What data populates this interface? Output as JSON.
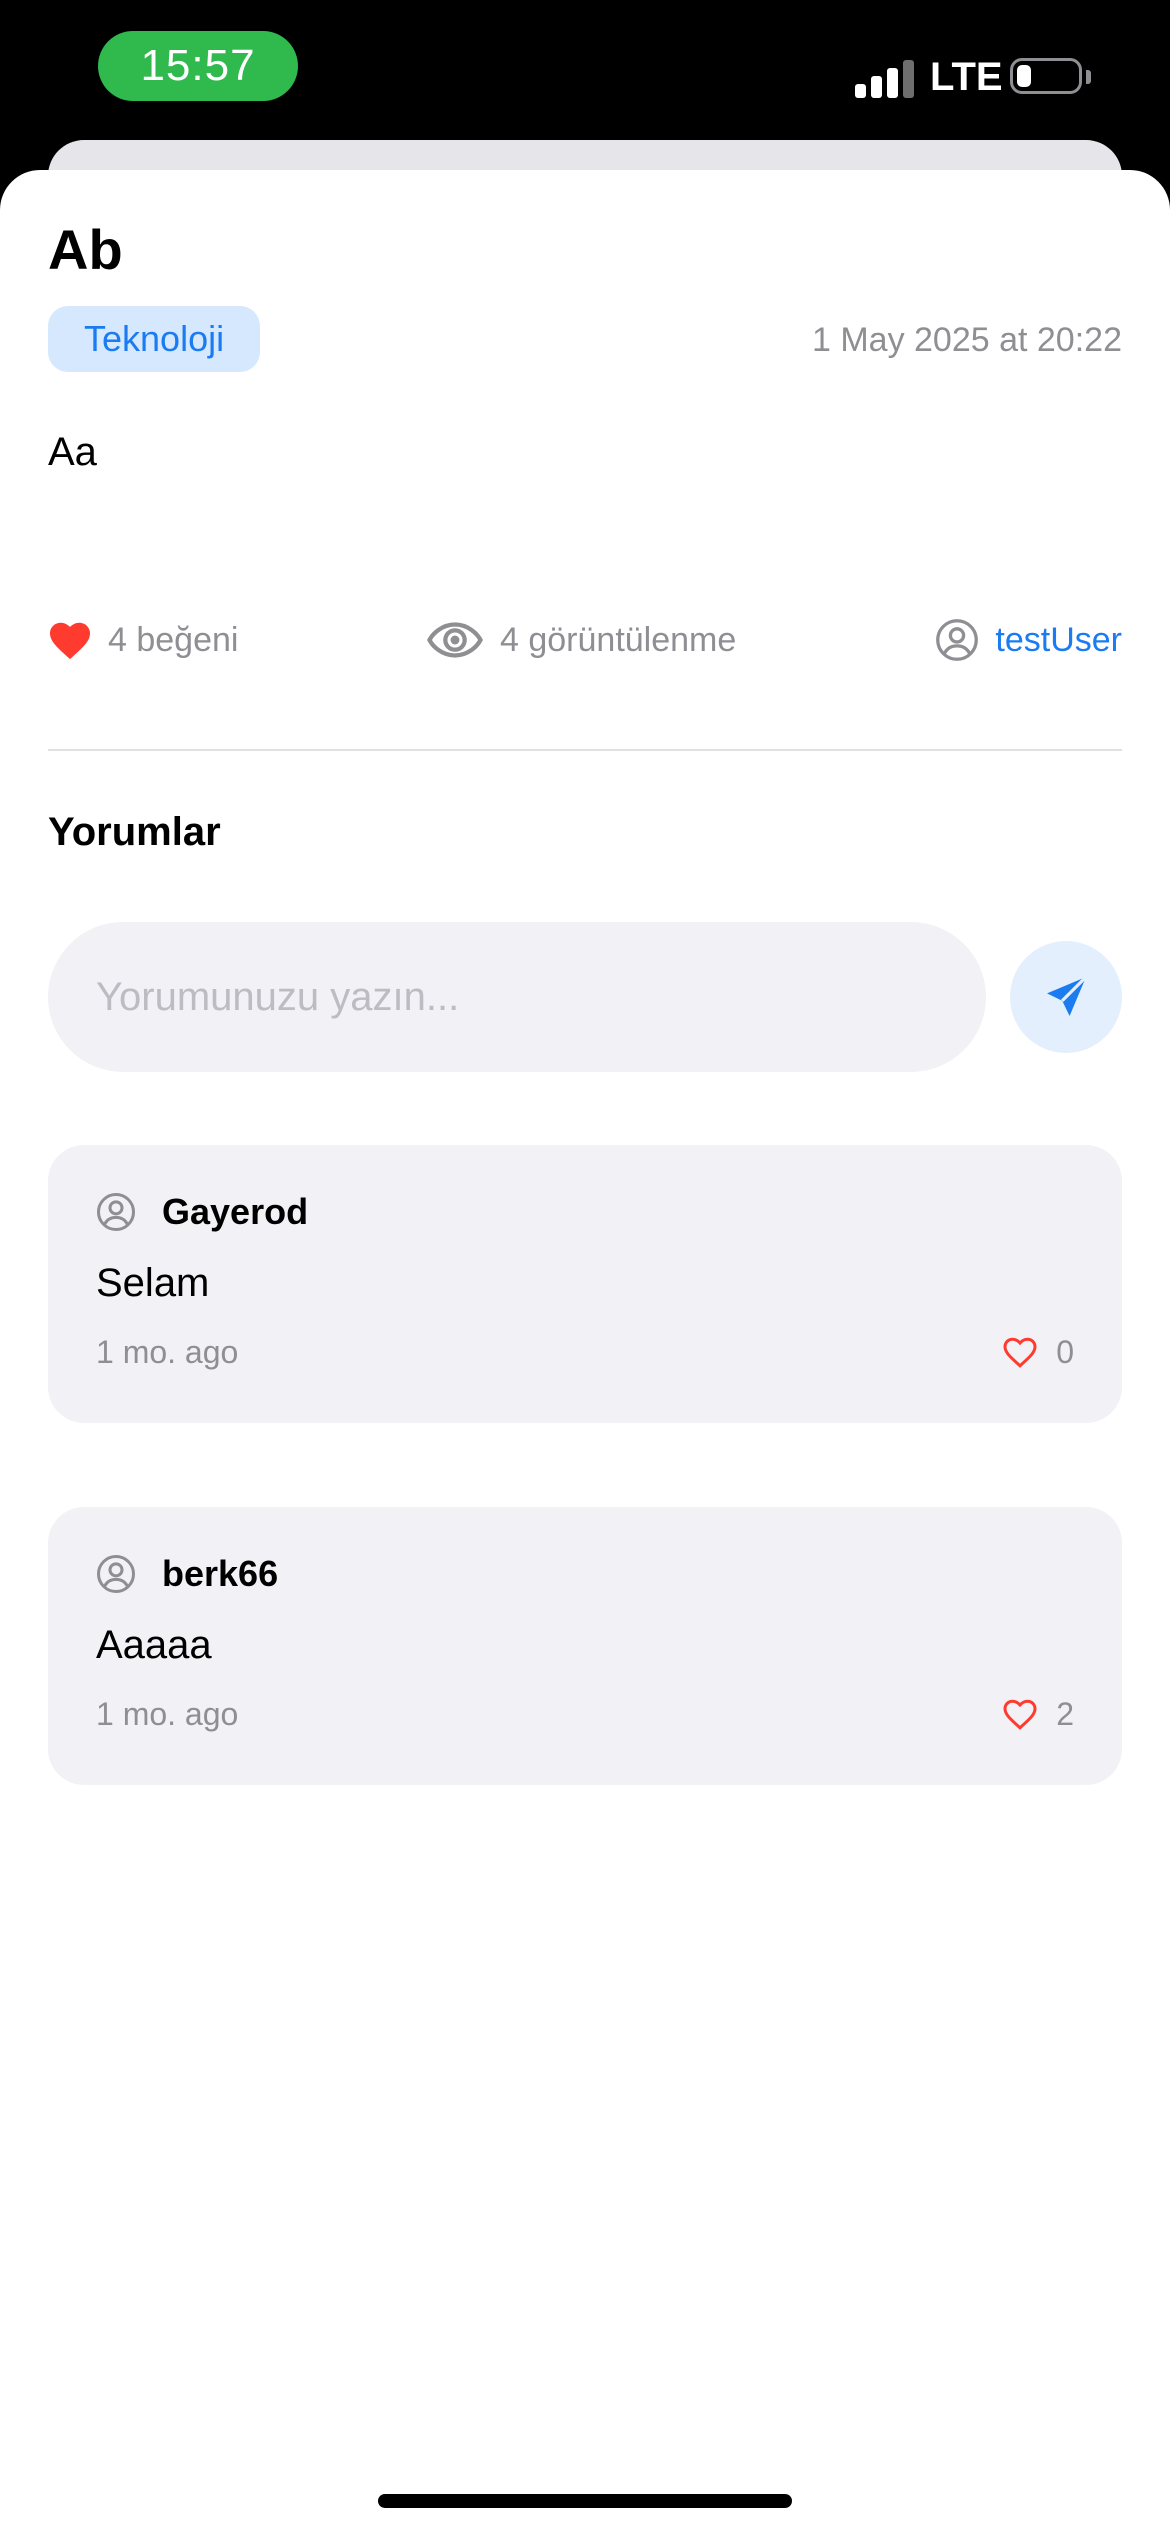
{
  "status_bar": {
    "time": "15:57",
    "network": "LTE"
  },
  "post": {
    "title": "Ab",
    "category": "Teknoloji",
    "date": "1 May 2025 at 20:22",
    "body": "Aa",
    "likes_label": "4 beğeni",
    "views_label": "4 görüntülenme",
    "author": "testUser"
  },
  "comments_section": {
    "heading": "Yorumlar",
    "input_placeholder": "Yorumunuzu yazın...",
    "comments": [
      {
        "user": "Gayerod",
        "text": "Selam",
        "time": "1 mo. ago",
        "likes": "0"
      },
      {
        "user": "berk66",
        "text": "Aaaaa",
        "time": "1 mo. ago",
        "likes": "2"
      }
    ]
  },
  "colors": {
    "accent": "#1a7cf0",
    "like_red": "#ff3b30",
    "status_green": "#30b94d",
    "card_background": "#f1f1f6",
    "secondary_text": "#8e8e93"
  },
  "icons": {
    "likes": "heart-filled-icon",
    "views": "eye-icon",
    "author": "person-circle-icon",
    "send": "paper-plane-icon",
    "comment_like": "heart-outline-icon"
  }
}
